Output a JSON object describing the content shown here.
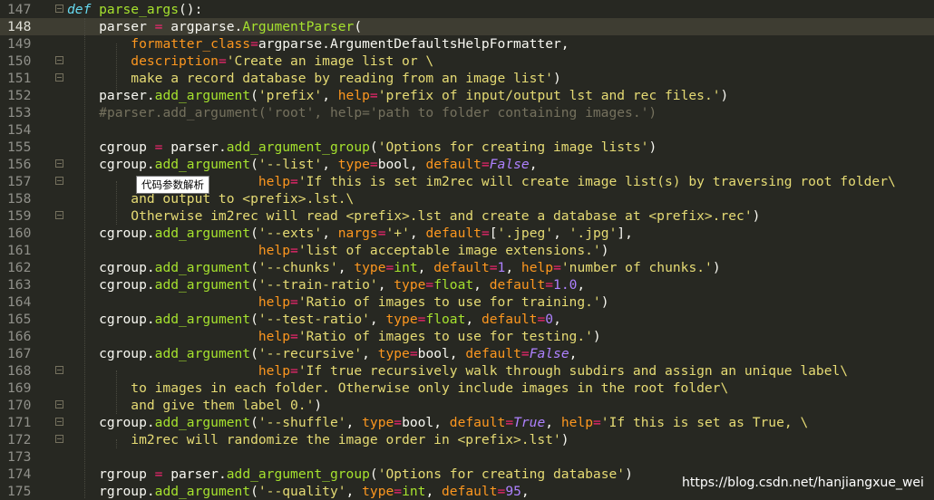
{
  "lines": [
    {
      "num": "147",
      "current": false,
      "fold": true,
      "tokens": [
        [
          "kw",
          "def"
        ],
        [
          "",
          ""
        ],
        [
          "fn",
          " parse_args"
        ],
        [
          "",
          "():"
        ]
      ]
    },
    {
      "num": "148",
      "current": true,
      "fold": false,
      "tokens": [
        [
          "",
          "    parser "
        ],
        [
          "op",
          "="
        ],
        [
          "",
          " argparse."
        ],
        [
          "fn",
          "ArgumentParser"
        ],
        [
          "",
          "("
        ]
      ]
    },
    {
      "num": "149",
      "current": false,
      "fold": false,
      "tokens": [
        [
          "",
          "        "
        ],
        [
          "param",
          "formatter_class"
        ],
        [
          "op",
          "="
        ],
        [
          "",
          "argparse.ArgumentDefaultsHelpFormatter,"
        ]
      ]
    },
    {
      "num": "150",
      "current": false,
      "fold": true,
      "tokens": [
        [
          "",
          "        "
        ],
        [
          "param",
          "description"
        ],
        [
          "op",
          "="
        ],
        [
          "str",
          "'Create an image list or \\"
        ]
      ]
    },
    {
      "num": "151",
      "current": false,
      "fold": true,
      "tokens": [
        [
          "str",
          "        make a record database by reading from an image list'"
        ],
        [
          "",
          ")"
        ]
      ]
    },
    {
      "num": "152",
      "current": false,
      "fold": false,
      "tokens": [
        [
          "",
          "    parser."
        ],
        [
          "fn",
          "add_argument"
        ],
        [
          "",
          "("
        ],
        [
          "str",
          "'prefix'"
        ],
        [
          ",",
          ", "
        ],
        [
          "param",
          "help"
        ],
        [
          "op",
          "="
        ],
        [
          "str",
          "'prefix of input/output lst and rec files.'"
        ],
        [
          "",
          ")"
        ]
      ]
    },
    {
      "num": "153",
      "current": false,
      "fold": false,
      "tokens": [
        [
          "",
          "    "
        ],
        [
          "cmt",
          "#parser.add_argument('root', help='path to folder containing images.')"
        ]
      ]
    },
    {
      "num": "154",
      "current": false,
      "fold": false,
      "tokens": [
        [
          "",
          ""
        ]
      ]
    },
    {
      "num": "155",
      "current": false,
      "fold": false,
      "tokens": [
        [
          "",
          "    cgroup "
        ],
        [
          "op",
          "="
        ],
        [
          "",
          " parser."
        ],
        [
          "fn",
          "add_argument_group"
        ],
        [
          "",
          "("
        ],
        [
          "str",
          "'Options for creating image lists'"
        ],
        [
          "",
          ")"
        ]
      ]
    },
    {
      "num": "156",
      "current": false,
      "fold": true,
      "tokens": [
        [
          "",
          "    cgroup."
        ],
        [
          "fn",
          "add_argument"
        ],
        [
          "",
          "("
        ],
        [
          "str",
          "'--list'"
        ],
        [
          "",
          ", "
        ],
        [
          "param",
          "type"
        ],
        [
          "op",
          "="
        ],
        [
          "",
          "bool, "
        ],
        [
          "param",
          "default"
        ],
        [
          "op",
          "="
        ],
        [
          "constI",
          "False"
        ],
        [
          "",
          ","
        ]
      ]
    },
    {
      "num": "157",
      "current": false,
      "fold": true,
      "tokens": [
        [
          "",
          "                        "
        ],
        [
          "param",
          "help"
        ],
        [
          "op",
          "="
        ],
        [
          "str",
          "'If this is set im2rec will create image list(s) by traversing root folder\\"
        ]
      ]
    },
    {
      "num": "158",
      "current": false,
      "fold": false,
      "tokens": [
        [
          "str",
          "        and output to <prefix>.lst.\\"
        ]
      ]
    },
    {
      "num": "159",
      "current": false,
      "fold": true,
      "tokens": [
        [
          "str",
          "        Otherwise im2rec will read <prefix>.lst and create a database at <prefix>.rec'"
        ],
        [
          "",
          ")"
        ]
      ]
    },
    {
      "num": "160",
      "current": false,
      "fold": false,
      "tokens": [
        [
          "",
          "    cgroup."
        ],
        [
          "fn",
          "add_argument"
        ],
        [
          "",
          "("
        ],
        [
          "str",
          "'--exts'"
        ],
        [
          "",
          ", "
        ],
        [
          "param",
          "nargs"
        ],
        [
          "op",
          "="
        ],
        [
          "str",
          "'+'"
        ],
        [
          "",
          ", "
        ],
        [
          "param",
          "default"
        ],
        [
          "op",
          "="
        ],
        [
          "",
          "["
        ],
        [
          "str",
          "'.jpeg'"
        ],
        [
          "",
          ", "
        ],
        [
          "str",
          "'.jpg'"
        ],
        [
          "",
          "],"
        ]
      ]
    },
    {
      "num": "161",
      "current": false,
      "fold": false,
      "tokens": [
        [
          "",
          "                        "
        ],
        [
          "param",
          "help"
        ],
        [
          "op",
          "="
        ],
        [
          "str",
          "'list of acceptable image extensions.'"
        ],
        [
          "",
          ")"
        ]
      ]
    },
    {
      "num": "162",
      "current": false,
      "fold": false,
      "tokens": [
        [
          "",
          "    cgroup."
        ],
        [
          "fn",
          "add_argument"
        ],
        [
          "",
          "("
        ],
        [
          "str",
          "'--chunks'"
        ],
        [
          "",
          ", "
        ],
        [
          "param",
          "type"
        ],
        [
          "op",
          "="
        ],
        [
          "fn",
          "int"
        ],
        [
          "",
          ", "
        ],
        [
          "param",
          "default"
        ],
        [
          "op",
          "="
        ],
        [
          "const",
          "1"
        ],
        [
          "",
          ", "
        ],
        [
          "param",
          "help"
        ],
        [
          "op",
          "="
        ],
        [
          "str",
          "'number of chunks.'"
        ],
        [
          "",
          ")"
        ]
      ]
    },
    {
      "num": "163",
      "current": false,
      "fold": false,
      "tokens": [
        [
          "",
          "    cgroup."
        ],
        [
          "fn",
          "add_argument"
        ],
        [
          "",
          "("
        ],
        [
          "str",
          "'--train-ratio'"
        ],
        [
          "",
          ", "
        ],
        [
          "param",
          "type"
        ],
        [
          "op",
          "="
        ],
        [
          "fn",
          "float"
        ],
        [
          "",
          ", "
        ],
        [
          "param",
          "default"
        ],
        [
          "op",
          "="
        ],
        [
          "const",
          "1.0"
        ],
        [
          "",
          ","
        ]
      ]
    },
    {
      "num": "164",
      "current": false,
      "fold": false,
      "tokens": [
        [
          "",
          "                        "
        ],
        [
          "param",
          "help"
        ],
        [
          "op",
          "="
        ],
        [
          "str",
          "'Ratio of images to use for training.'"
        ],
        [
          "",
          ")"
        ]
      ]
    },
    {
      "num": "165",
      "current": false,
      "fold": false,
      "tokens": [
        [
          "",
          "    cgroup."
        ],
        [
          "fn",
          "add_argument"
        ],
        [
          "",
          "("
        ],
        [
          "str",
          "'--test-ratio'"
        ],
        [
          "",
          ", "
        ],
        [
          "param",
          "type"
        ],
        [
          "op",
          "="
        ],
        [
          "fn",
          "float"
        ],
        [
          "",
          ", "
        ],
        [
          "param",
          "default"
        ],
        [
          "op",
          "="
        ],
        [
          "const",
          "0"
        ],
        [
          "",
          ","
        ]
      ]
    },
    {
      "num": "166",
      "current": false,
      "fold": false,
      "tokens": [
        [
          "",
          "                        "
        ],
        [
          "param",
          "help"
        ],
        [
          "op",
          "="
        ],
        [
          "str",
          "'Ratio of images to use for testing.'"
        ],
        [
          "",
          ")"
        ]
      ]
    },
    {
      "num": "167",
      "current": false,
      "fold": false,
      "tokens": [
        [
          "",
          "    cgroup."
        ],
        [
          "fn",
          "add_argument"
        ],
        [
          "",
          "("
        ],
        [
          "str",
          "'--recursive'"
        ],
        [
          "",
          ", "
        ],
        [
          "param",
          "type"
        ],
        [
          "op",
          "="
        ],
        [
          "",
          "bool, "
        ],
        [
          "param",
          "default"
        ],
        [
          "op",
          "="
        ],
        [
          "constI",
          "False"
        ],
        [
          "",
          ","
        ]
      ]
    },
    {
      "num": "168",
      "current": false,
      "fold": true,
      "tokens": [
        [
          "",
          "                        "
        ],
        [
          "param",
          "help"
        ],
        [
          "op",
          "="
        ],
        [
          "str",
          "'If true recursively walk through subdirs and assign an unique label\\"
        ]
      ]
    },
    {
      "num": "169",
      "current": false,
      "fold": false,
      "tokens": [
        [
          "str",
          "        to images in each folder. Otherwise only include images in the root folder\\"
        ]
      ]
    },
    {
      "num": "170",
      "current": false,
      "fold": true,
      "tokens": [
        [
          "str",
          "        and give them label 0.'"
        ],
        [
          "",
          ")"
        ]
      ]
    },
    {
      "num": "171",
      "current": false,
      "fold": true,
      "tokens": [
        [
          "",
          "    cgroup."
        ],
        [
          "fn",
          "add_argument"
        ],
        [
          "",
          "("
        ],
        [
          "str",
          "'--shuffle'"
        ],
        [
          "",
          ", "
        ],
        [
          "param",
          "type"
        ],
        [
          "op",
          "="
        ],
        [
          "",
          "bool, "
        ],
        [
          "param",
          "default"
        ],
        [
          "op",
          "="
        ],
        [
          "constI",
          "True"
        ],
        [
          "",
          ", "
        ],
        [
          "param",
          "help"
        ],
        [
          "op",
          "="
        ],
        [
          "str",
          "'If this is set as True, \\"
        ]
      ]
    },
    {
      "num": "172",
      "current": false,
      "fold": true,
      "tokens": [
        [
          "str",
          "        im2rec will randomize the image order in <prefix>.lst'"
        ],
        [
          "",
          ")"
        ]
      ]
    },
    {
      "num": "173",
      "current": false,
      "fold": false,
      "tokens": [
        [
          "",
          ""
        ]
      ]
    },
    {
      "num": "174",
      "current": false,
      "fold": false,
      "tokens": [
        [
          "",
          "    rgroup "
        ],
        [
          "op",
          "="
        ],
        [
          "",
          " parser."
        ],
        [
          "fn",
          "add_argument_group"
        ],
        [
          "",
          "("
        ],
        [
          "str",
          "'Options for creating database'"
        ],
        [
          "",
          ")"
        ]
      ]
    },
    {
      "num": "175",
      "current": false,
      "fold": false,
      "tokens": [
        [
          "",
          "    rgroup."
        ],
        [
          "fn",
          "add_argument"
        ],
        [
          "",
          "("
        ],
        [
          "str",
          "'--quality'"
        ],
        [
          "",
          ", "
        ],
        [
          "param",
          "type"
        ],
        [
          "op",
          "="
        ],
        [
          "fn",
          "int"
        ],
        [
          "",
          ", "
        ],
        [
          "param",
          "default"
        ],
        [
          "op",
          "="
        ],
        [
          "const",
          "95"
        ],
        [
          "",
          ","
        ]
      ]
    }
  ],
  "tooltip": {
    "text": "代码参数解析"
  },
  "watermark": {
    "text": "https://blog.csdn.net/hanjiangxue_wei"
  },
  "colors": {
    "background": "#272822",
    "keyword": "#66d9ef",
    "function": "#a6e22e",
    "operator": "#f92672",
    "string": "#e6db74",
    "parameter": "#fd971f",
    "constant": "#ae81ff",
    "comment": "#75715e"
  }
}
